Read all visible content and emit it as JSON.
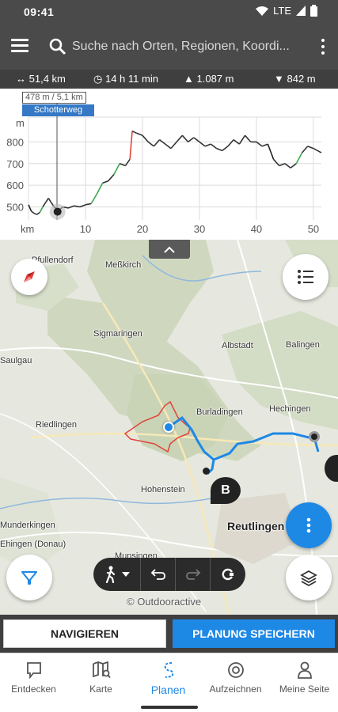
{
  "status": {
    "time": "09:41",
    "network": "LTE"
  },
  "search": {
    "placeholder": "Suche nach Orten, Regionen, Koordi..."
  },
  "stats": {
    "distance": "51,4 km",
    "duration": "14 h 11 min",
    "ascent": "1.087 m",
    "descent": "842 m"
  },
  "elevation": {
    "tooltip_value": "478 m / 5,1 km",
    "tooltip_surface": "Schotterweg",
    "y_unit": "m",
    "x_unit": "km",
    "chart_data": {
      "type": "line",
      "xlabel": "km",
      "ylabel": "m",
      "x_ticks": [
        10,
        20,
        30,
        40,
        50
      ],
      "y_ticks": [
        500,
        600,
        700,
        800
      ],
      "xlim": [
        0,
        51.4
      ],
      "ylim": [
        440,
        900
      ],
      "series": [
        {
          "x": [
            0,
            0.5,
            1,
            1.5,
            2,
            2.5,
            3,
            3.5,
            4,
            4.5,
            5,
            5.1,
            6,
            7,
            8,
            9,
            10,
            11,
            12,
            13,
            14,
            15,
            16,
            17,
            17.8,
            18.2,
            19,
            20,
            21,
            22,
            23,
            24,
            25,
            26,
            27,
            28,
            29,
            30,
            31,
            32,
            33,
            34,
            35,
            36,
            37,
            38,
            39,
            40,
            41,
            42,
            43,
            44,
            45,
            46,
            47,
            48,
            49,
            50,
            51.4
          ],
          "y": [
            510,
            480,
            470,
            465,
            475,
            500,
            520,
            540,
            520,
            500,
            490,
            478,
            500,
            495,
            505,
            500,
            510,
            515,
            560,
            610,
            620,
            650,
            700,
            690,
            720,
            850,
            840,
            830,
            800,
            780,
            810,
            790,
            770,
            800,
            830,
            800,
            820,
            800,
            780,
            790,
            770,
            760,
            780,
            810,
            790,
            830,
            800,
            800,
            780,
            790,
            720,
            690,
            700,
            680,
            700,
            750,
            780,
            770,
            750
          ]
        }
      ]
    }
  },
  "map": {
    "places": [
      "Meßkirch",
      "Sigmaringen",
      "Albstadt",
      "Balingen",
      "Hechingen",
      "Burladingen",
      "Riedlingen",
      "Hohenstein",
      "Reutlingen",
      "Munderkingen",
      "Munsingen",
      "Ehingen (Donau)",
      "Saulgau",
      "Pfullendorf"
    ],
    "marker_label": "B",
    "copyright": "© Outdooractive"
  },
  "actions": {
    "navigate": "NAVIGIEREN",
    "save": "PLANUNG SPEICHERN"
  },
  "nav": [
    {
      "label": "Entdecken",
      "icon": "chat-bubble-icon"
    },
    {
      "label": "Karte",
      "icon": "map-search-icon"
    },
    {
      "label": "Planen",
      "icon": "route-plan-icon"
    },
    {
      "label": "Aufzeichnen",
      "icon": "record-icon"
    },
    {
      "label": "Meine Seite",
      "icon": "person-icon"
    }
  ],
  "colors": {
    "accent": "#1e88e5",
    "route": "#1e88e5",
    "elev_green": "#3aa84a",
    "elev_red": "#e0453a"
  }
}
